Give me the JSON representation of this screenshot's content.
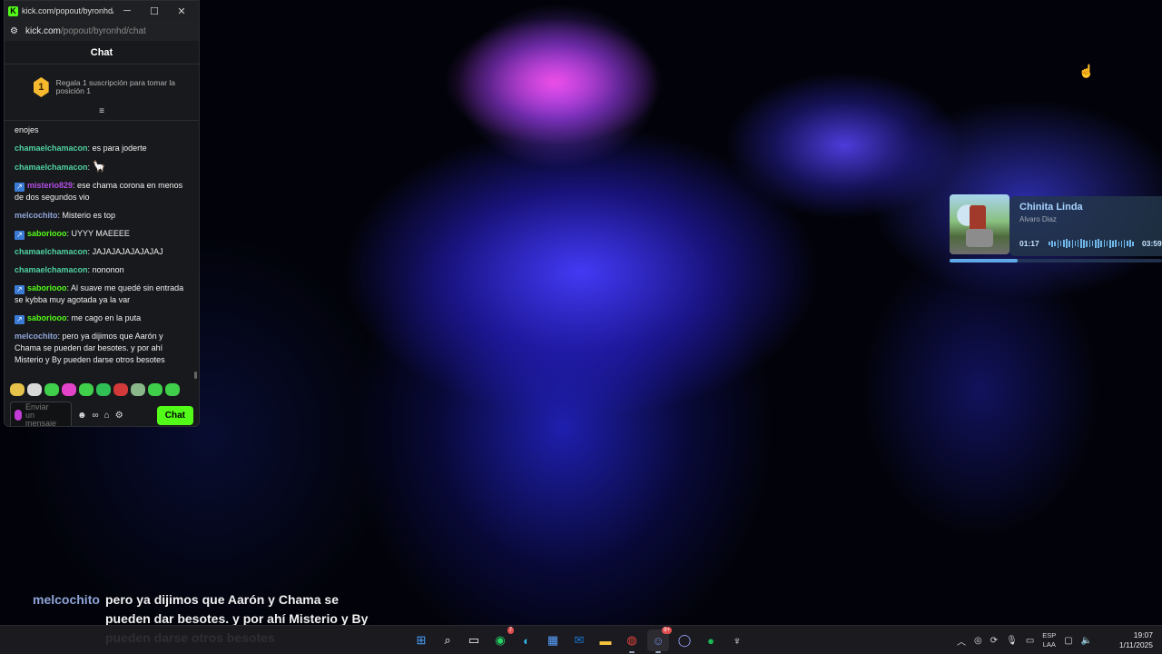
{
  "popout": {
    "window_title": "kick.com/popout/byronhd/c...",
    "url_domain": "kick.com",
    "url_path": "/popout/byronhd/chat",
    "chat_header": "Chat",
    "sub_rank": "1",
    "sub_gift_text": "Regala 1 suscripción para tomar la posición 1",
    "messages": [
      {
        "user": "",
        "text": "enojes",
        "color": "#f1f1f1",
        "badge": false
      },
      {
        "user": "chamaelchamacon",
        "text": "es para joderte",
        "color": "#4fd1a1",
        "badge": false
      },
      {
        "user": "chamaelchamacon",
        "text": "",
        "color": "#4fd1a1",
        "badge": false,
        "emote": "🦙"
      },
      {
        "user": "misterio829",
        "text": "ese chama corona en menos de dos segundos vio",
        "color": "#b34fe6",
        "badge": true
      },
      {
        "user": "melcochito",
        "text": "Misterio es top",
        "color": "#8ea4d8",
        "badge": false
      },
      {
        "user": "saboriooo",
        "text": "UYYY MAEEEE",
        "color": "#53fc18",
        "badge": true
      },
      {
        "user": "chamaelchamacon",
        "text": "JAJAJAJAJAJAJAJ",
        "color": "#4fd1a1",
        "badge": false
      },
      {
        "user": "chamaelchamacon",
        "text": "nononon",
        "color": "#4fd1a1",
        "badge": false
      },
      {
        "user": "saboriooo",
        "text": "Al suave me quedé sin entrada se kybba muy agotada ya la var",
        "color": "#53fc18",
        "badge": true
      },
      {
        "user": "saboriooo",
        "text": "me cago en la puta",
        "color": "#53fc18",
        "badge": true
      },
      {
        "user": "melcochito",
        "text": "pero ya dijimos que Aarón y Chama se pueden dar besotes. y por ahí Misterio y By pueden darse otros besotes",
        "color": "#8ea4d8",
        "badge": false
      }
    ],
    "input_placeholder": "Enviar un mensaje",
    "send_label": "Chat"
  },
  "now_playing": {
    "title": "Chinita Linda",
    "artist": "Alvaro Diaz",
    "elapsed": "01:17",
    "duration": "03:59",
    "progress": 0.32
  },
  "overlay": {
    "user": "melcochito",
    "text": "pero ya dijimos que Aarón y Chama se pueden dar besotes. y por ahí Misterio y By pueden darse otros besotes"
  },
  "taskbar": {
    "lang_top": "ESP",
    "lang_bottom": "LAA",
    "time": "19:07",
    "date": "1/11/2025",
    "whatsapp_badge": "7",
    "discord_badge": "9+"
  },
  "colors": {
    "kick_green": "#53fc18",
    "np_accent": "#5fa8e8"
  }
}
